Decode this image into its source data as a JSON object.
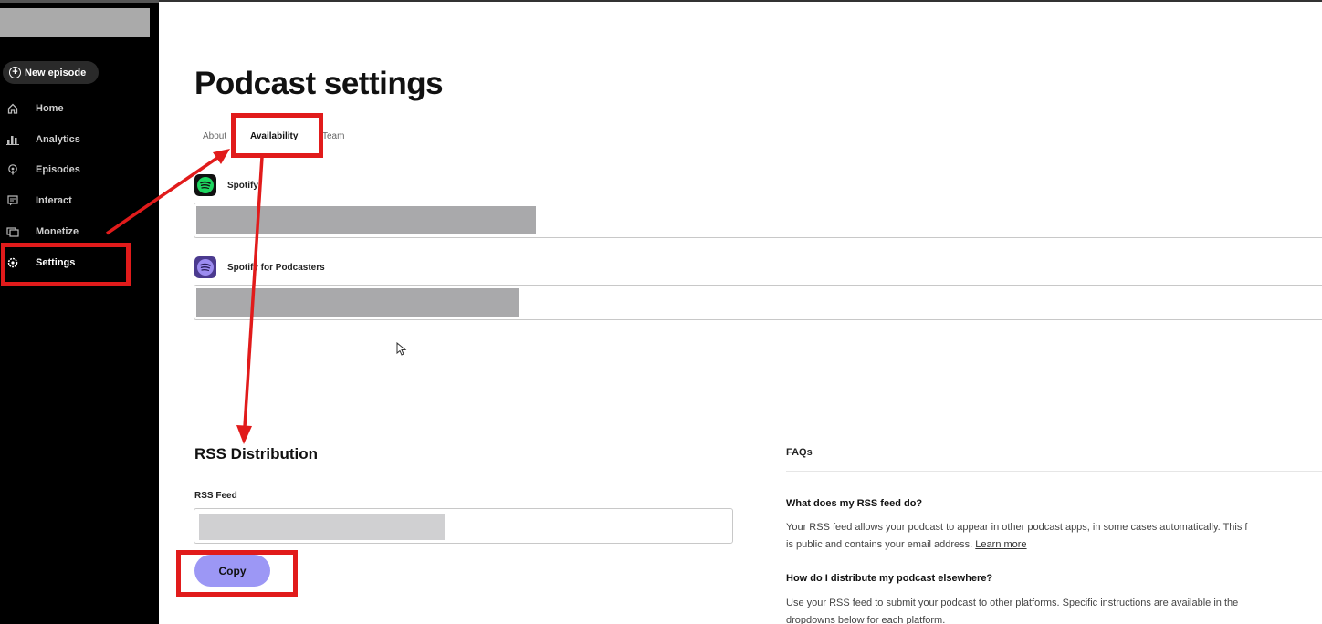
{
  "sidebar": {
    "new_episode": "New episode",
    "items": [
      {
        "label": "Home",
        "icon": "home-icon"
      },
      {
        "label": "Analytics",
        "icon": "analytics-icon"
      },
      {
        "label": "Episodes",
        "icon": "episodes-icon"
      },
      {
        "label": "Interact",
        "icon": "interact-icon"
      },
      {
        "label": "Monetize",
        "icon": "monetize-icon"
      },
      {
        "label": "Settings",
        "icon": "settings-icon",
        "active": true
      }
    ]
  },
  "page": {
    "title": "Podcast settings",
    "tabs": [
      {
        "label": "About"
      },
      {
        "label": "Availability",
        "active": true
      },
      {
        "label": "Team"
      }
    ]
  },
  "platforms": [
    {
      "name": "Spotify",
      "icon": "spotify-icon"
    },
    {
      "name": "Spotify for Podcasters",
      "icon": "spotify-for-podcasters-icon"
    }
  ],
  "rss": {
    "title": "RSS Distribution",
    "feed_label": "RSS Feed",
    "copy_label": "Copy"
  },
  "faqs": {
    "title": "FAQs",
    "items": [
      {
        "question": "What does my RSS feed do?",
        "answer_line1": "Your RSS feed allows your podcast to appear in other podcast apps, in some cases automatically. This f",
        "answer_line2": "is public and contains your email address.",
        "link": "Learn more"
      },
      {
        "question": "How do I distribute my podcast elsewhere?",
        "answer_line1": "Use your RSS feed to submit your podcast to other platforms. Specific instructions are available in the",
        "answer_line2": "dropdowns below for each platform."
      }
    ]
  },
  "colors": {
    "annotation_red": "#e11b1b",
    "copy_button": "#9c97f5",
    "sidebar_bg": "#000000"
  }
}
